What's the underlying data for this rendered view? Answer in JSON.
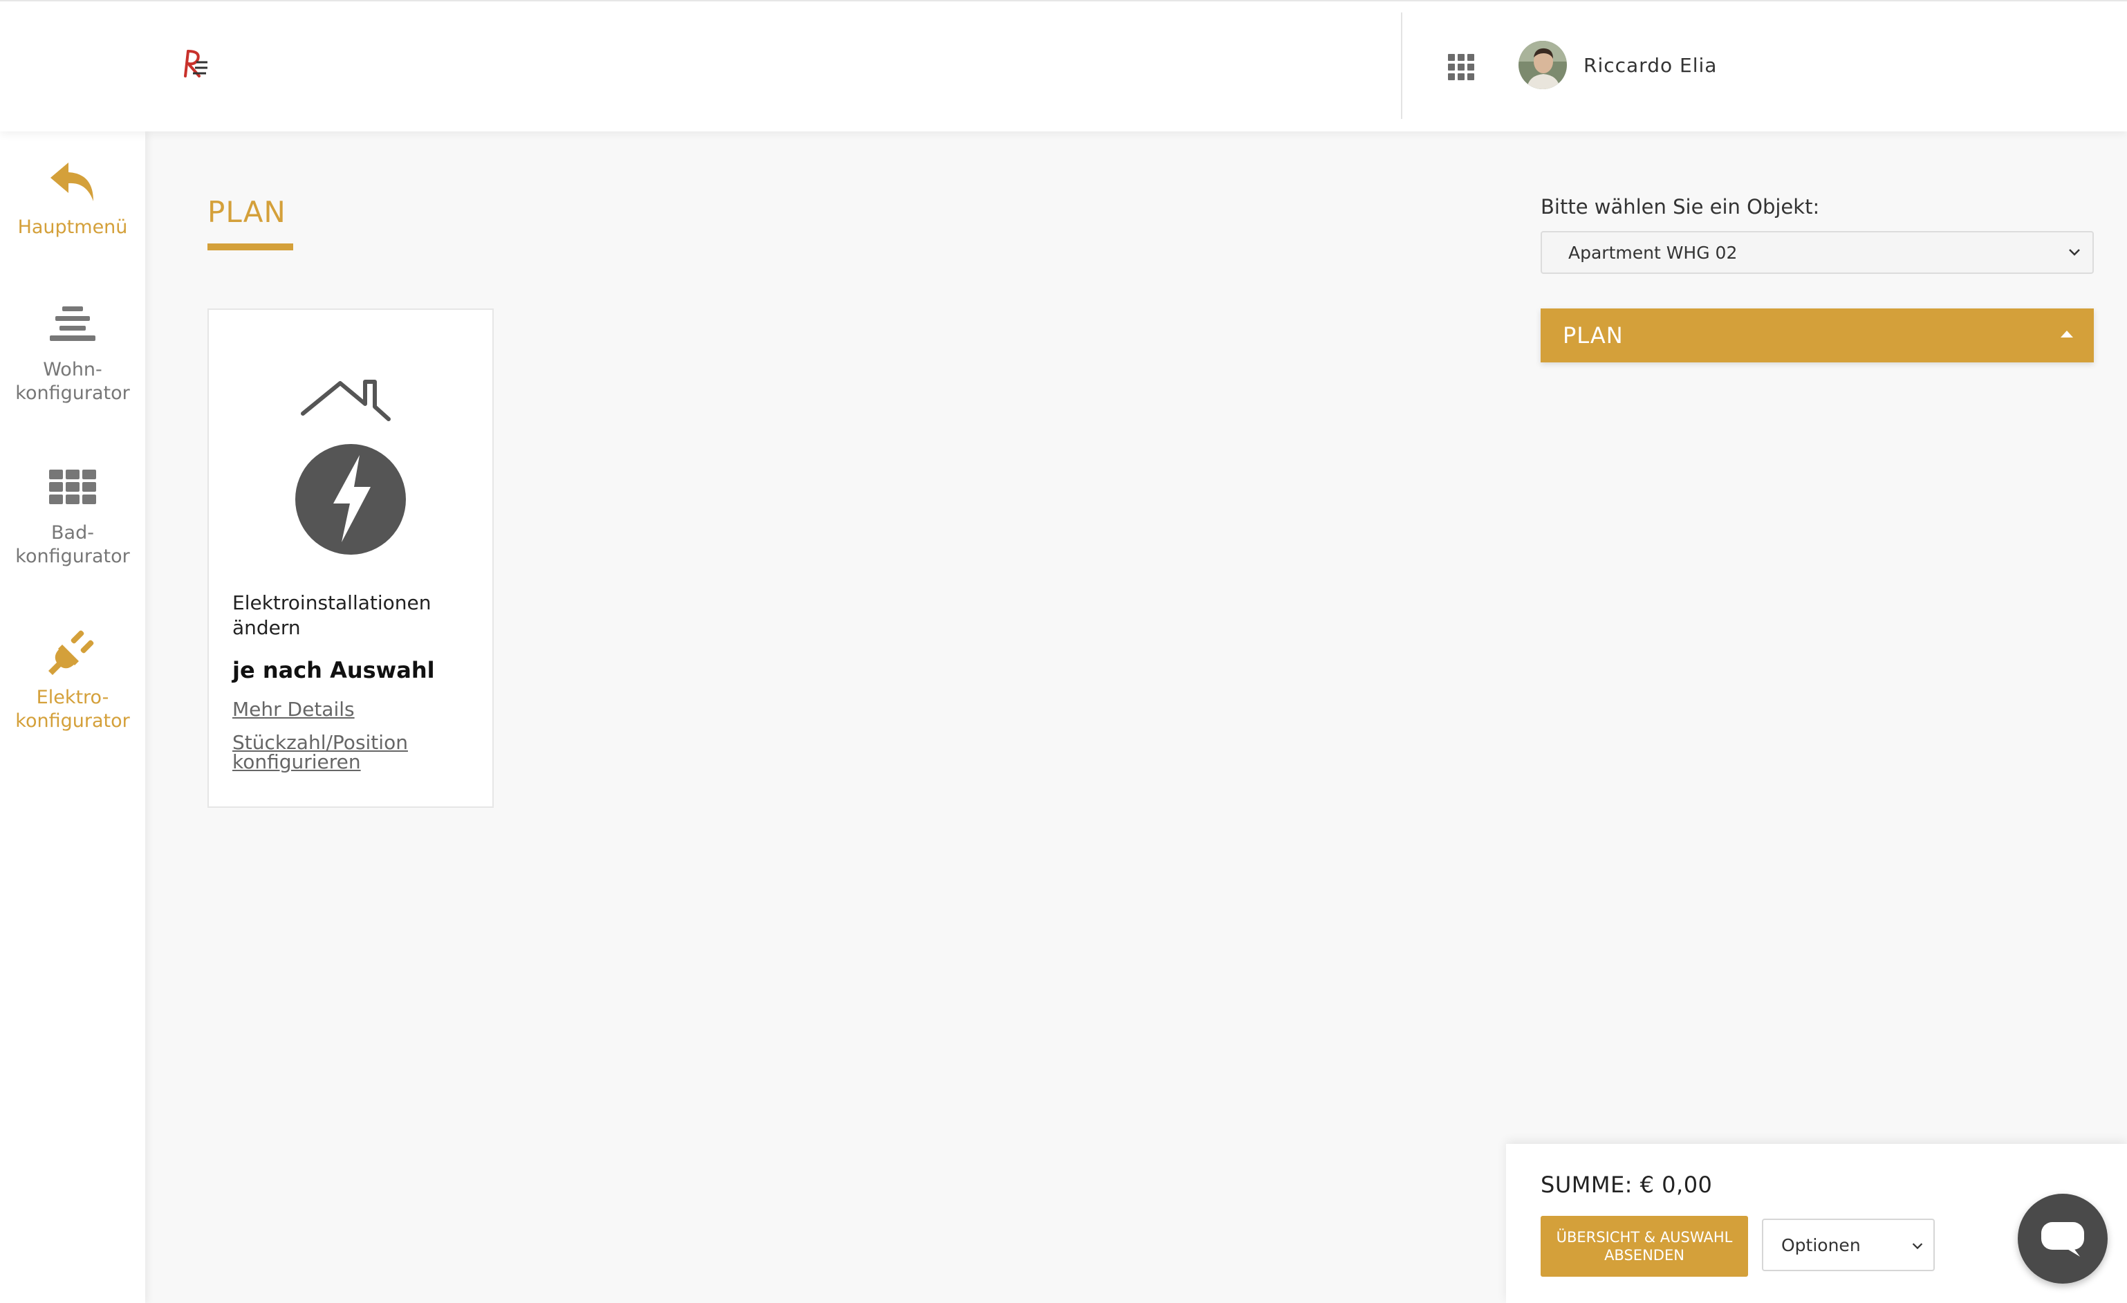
{
  "header": {
    "logo_icon": "re-logo-icon",
    "apps_icon": "grid-icon",
    "user_name": "Riccardo Elia"
  },
  "sidebar": {
    "items": [
      {
        "label": "Hauptmenü",
        "icon": "reply-arrow-icon",
        "color": "#d4a03a"
      },
      {
        "label": "Wohn-\nkonfigurator",
        "icon": "layers-icon",
        "color": "#777777"
      },
      {
        "label": "Bad-\nkonfigurator",
        "icon": "tiles-icon",
        "color": "#777777"
      },
      {
        "label": "Elektro-\nkonfigurator",
        "icon": "plug-icon",
        "color": "#d4a03a"
      }
    ]
  },
  "main": {
    "title": "PLAN",
    "card": {
      "image_icon": "house-lightning-icon",
      "title": "Elektroinstallationen ändern",
      "price": "je nach Auswahl",
      "link_details": "Mehr Details",
      "link_configure": "Stückzahl/Position konfigurieren"
    }
  },
  "right_panel": {
    "object_label": "Bitte wählen Sie ein Objekt:",
    "object_value": "Apartment WHG 02",
    "accordion_label": "PLAN"
  },
  "summary": {
    "sum_text": "SUMME: € 0,00",
    "submit_label": "ÜBERSICHT & AUSWAHL ABSENDEN",
    "options_value": "Optionen",
    "chat_icon": "chat-bubble-icon"
  },
  "colors": {
    "accent": "#d4a03a",
    "background": "#f8f8f8",
    "text_dark": "#222222",
    "icon_gray": "#555555"
  }
}
